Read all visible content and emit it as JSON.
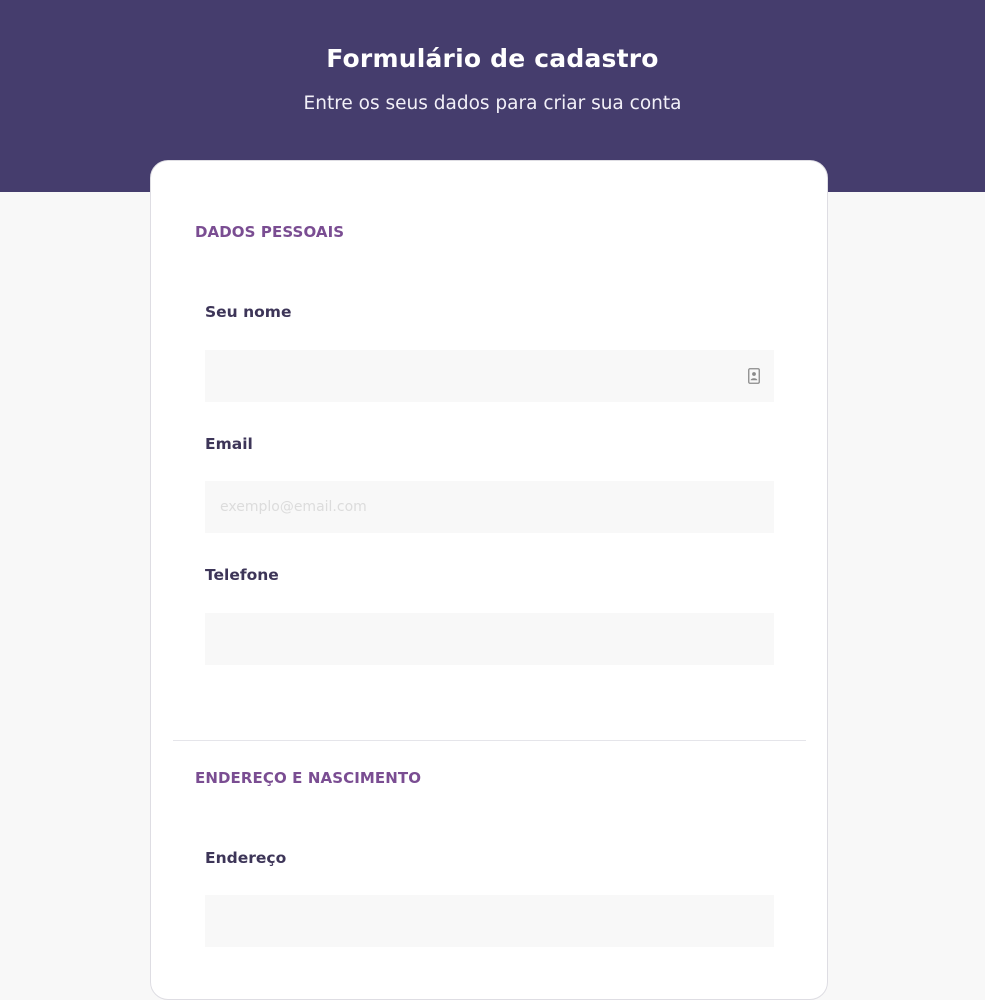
{
  "header": {
    "title": "Formulário de cadastro",
    "subtitle": "Entre os seus dados para criar sua conta"
  },
  "sections": [
    {
      "title": "DADOS PESSOAIS",
      "fields": [
        {
          "label": "Seu nome",
          "value": "",
          "placeholder": "",
          "icon": "contact-card-icon"
        },
        {
          "label": "Email",
          "value": "",
          "placeholder": "exemplo@email.com"
        },
        {
          "label": "Telefone",
          "value": "",
          "placeholder": ""
        }
      ]
    },
    {
      "title": "ENDEREÇO E NASCIMENTO",
      "fields": [
        {
          "label": "Endereço",
          "value": "",
          "placeholder": ""
        }
      ]
    }
  ],
  "colors": {
    "header_background": "#453d6d",
    "section_title": "#7a4d92",
    "label": "#3d3558",
    "page_background": "#f8f8f8",
    "input_background": "#f8f8f8"
  }
}
